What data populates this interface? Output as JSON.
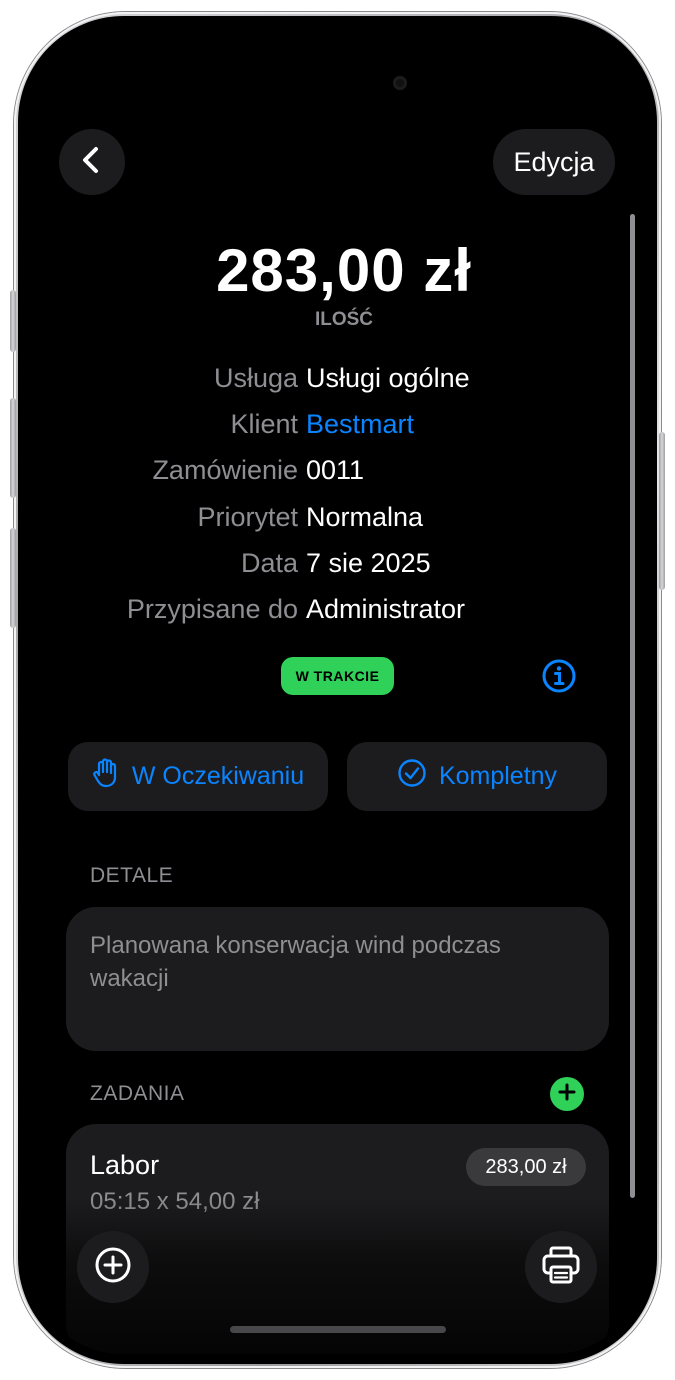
{
  "header": {
    "back_icon": "chevron-left-icon",
    "edit_label": "Edycja"
  },
  "summary": {
    "amount": "283,00 zł",
    "amount_label": "ILOŚĆ"
  },
  "info": {
    "service": {
      "label": "Usługa",
      "value": "Usługi ogólne"
    },
    "client": {
      "label": "Klient",
      "value": "Bestmart"
    },
    "order": {
      "label": "Zamówienie",
      "value": "0011"
    },
    "priority": {
      "label": "Priorytet",
      "value": "Normalna"
    },
    "date": {
      "label": "Data",
      "value": "7 sie 2025"
    },
    "assigned": {
      "label": "Przypisane do",
      "value": "Administrator"
    }
  },
  "status": {
    "badge": "W TRAKCIE",
    "badge_color": "#30d158",
    "info_icon": "info-circle-icon"
  },
  "actions": {
    "hold": {
      "label": "W Oczekiwaniu",
      "icon": "hand-icon"
    },
    "complete": {
      "label": "Kompletny",
      "icon": "checkmark-circle-icon"
    }
  },
  "details": {
    "header": "DETALE",
    "text": "Planowana konserwacja wind podczas wakacji"
  },
  "tasks": {
    "header": "ZADANIA",
    "add_icon": "plus-icon",
    "items": [
      {
        "title": "Labor",
        "subtitle": "05:15 x 54,00 zł",
        "price": "283,00 zł"
      }
    ]
  },
  "bottom": {
    "add_icon": "plus-circle-icon",
    "print_icon": "printer-icon"
  },
  "colors": {
    "accent": "#0a84ff",
    "success": "#30d158",
    "card": "#1c1c1e",
    "secondary_text": "#8e8e93"
  }
}
